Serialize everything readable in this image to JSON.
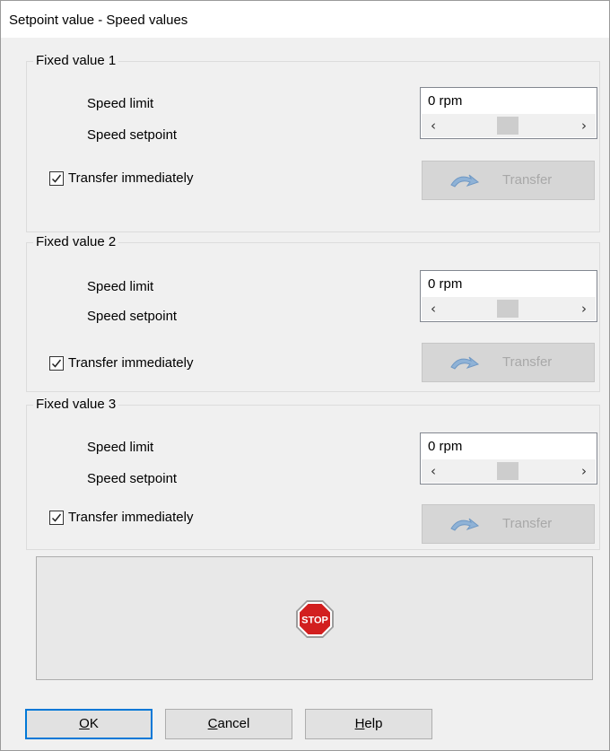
{
  "window": {
    "title": "Setpoint value - Speed values"
  },
  "groups": [
    {
      "legend": "Fixed value 1",
      "speed_limit_label": "Speed limit",
      "speed_setpoint_label": "Speed setpoint",
      "value": "0 rpm",
      "transfer_immediately_label": "Transfer immediately",
      "transfer_immediately_checked": true,
      "transfer_button_label": "Transfer",
      "transfer_button_enabled": false,
      "slider_position": 0.5
    },
    {
      "legend": "Fixed value 2",
      "speed_limit_label": "Speed limit",
      "speed_setpoint_label": "Speed setpoint",
      "value": "0 rpm",
      "transfer_immediately_label": "Transfer immediately",
      "transfer_immediately_checked": true,
      "transfer_button_label": "Transfer",
      "transfer_button_enabled": false,
      "slider_position": 0.5
    },
    {
      "legend": "Fixed value 3",
      "speed_limit_label": "Speed limit",
      "speed_setpoint_label": "Speed setpoint",
      "value": "0 rpm",
      "transfer_immediately_label": "Transfer immediately",
      "transfer_immediately_checked": true,
      "transfer_button_label": "Transfer",
      "transfer_button_enabled": false,
      "slider_position": 0.5
    }
  ],
  "stop": {
    "icon": "stop-sign-icon",
    "text": "STOP",
    "color": "#d21f1f"
  },
  "buttons": {
    "ok": {
      "label": "OK",
      "mnemonic": "O",
      "rest": "K"
    },
    "cancel": {
      "label": "Cancel",
      "mnemonic": "C",
      "rest": "ancel"
    },
    "help": {
      "label": "Help",
      "mnemonic": "H",
      "rest": "elp"
    }
  },
  "icons": {
    "transfer": "transfer-arrow-icon",
    "scroll_left": "chevron-left-icon",
    "scroll_right": "chevron-right-icon",
    "checkbox": "checkmark-icon"
  },
  "colors": {
    "default_button_border": "#0078d7",
    "disabled_text": "#a8a8a8",
    "transfer_icon": "#8fb2d6"
  }
}
